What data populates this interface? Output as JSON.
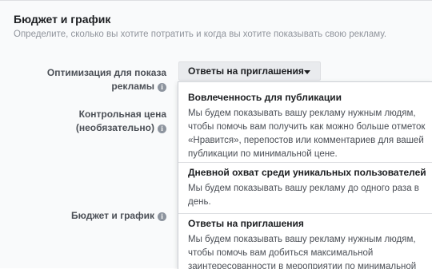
{
  "header": {
    "title": "Бюджет и график",
    "subtitle": "Определите, сколько вы хотите потратить и когда вы хотите показывать свою рекламу."
  },
  "fields": {
    "optimization_label_line1": "Оптимизация для показа",
    "optimization_label_line2": "рекламы",
    "bid_label_line1": "Контрольная цена",
    "bid_label_line2": "(необязательно)",
    "budget_label": "Бюджет и график",
    "info_glyph": "i"
  },
  "dropdown": {
    "selected": "Ответы на приглашения"
  },
  "options": [
    {
      "title": "Вовлеченность для публикации",
      "desc": [
        "Мы будем показывать вашу рекламу нужным людям,",
        "чтобы помочь вам получить как можно больше отметок",
        "«Нравится», перепостов или комментариев для вашей",
        "публикации по минимальной цене."
      ]
    },
    {
      "title": "Дневной охват среди уникальных пользователей",
      "desc": [
        "Мы будем показывать вашу рекламу до одного раза в",
        "день."
      ]
    },
    {
      "title": "Ответы на приглашения",
      "desc": [
        "Мы будем показывать вашу рекламу нужным людям,",
        "чтобы помочь вам добиться максимальной",
        "заинтересованности в мероприятии по минимальной"
      ]
    }
  ],
  "colors": {
    "panel_bg": "#f9fafb",
    "dropdown_bg": "#e9ebee",
    "label_text": "#4b4f56",
    "subtitle_text": "#90949c",
    "info_icon": "#8d949e"
  }
}
